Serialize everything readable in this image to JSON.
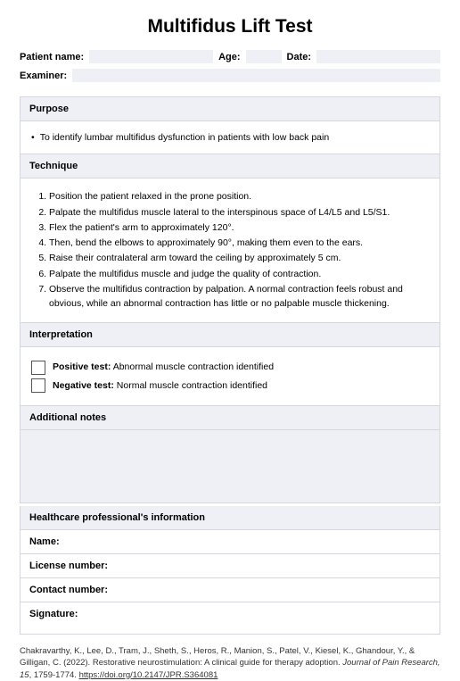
{
  "title": "Multifidus Lift Test",
  "patient": {
    "name_label": "Patient name:",
    "age_label": "Age:",
    "date_label": "Date:",
    "examiner_label": "Examiner:"
  },
  "purpose": {
    "header": "Purpose",
    "item": "To identify lumbar multifidus dysfunction in patients with low back pain"
  },
  "technique": {
    "header": "Technique",
    "steps": [
      "Position the patient relaxed in the prone position.",
      "Palpate the multifidus muscle lateral to the interspinous space of L4/L5 and L5/S1.",
      "Flex the patient's arm to approximately 120°.",
      "Then, bend the elbows to approximately 90°, making them even to the ears.",
      "Raise their contralateral arm toward the ceiling by approximately 5 cm.",
      "Palpate the multifidus muscle and judge the quality of contraction.",
      "Observe the multifidus contraction by palpation. A normal contraction feels robust and obvious, while an abnormal contraction has little or no palpable muscle thickening."
    ]
  },
  "interpretation": {
    "header": "Interpretation",
    "positive_label": "Positive test:",
    "positive_desc": " Abnormal muscle contraction identified",
    "negative_label": "Negative test:",
    "negative_desc": " Normal muscle contraction identified"
  },
  "notes": {
    "header": "Additional notes"
  },
  "hp": {
    "header": "Healthcare professional's information",
    "name_label": "Name:",
    "license_label": "License number:",
    "contact_label": "Contact number:",
    "signature_label": "Signature:"
  },
  "reference": {
    "text_before": "Chakravarthy, K., Lee, D., Tram, J., Sheth, S., Heros, R., Manion, S., Patel, V., Kiesel, K., Ghandour, Y., & Gilligan, C. (2022). Restorative neurostimulation: A clinical guide for therapy adoption. ",
    "journal": "Journal of Pain Research, 15",
    "text_mid": ", 1759-1774. ",
    "link": "https://doi.org/10.2147/JPR.S364081"
  }
}
